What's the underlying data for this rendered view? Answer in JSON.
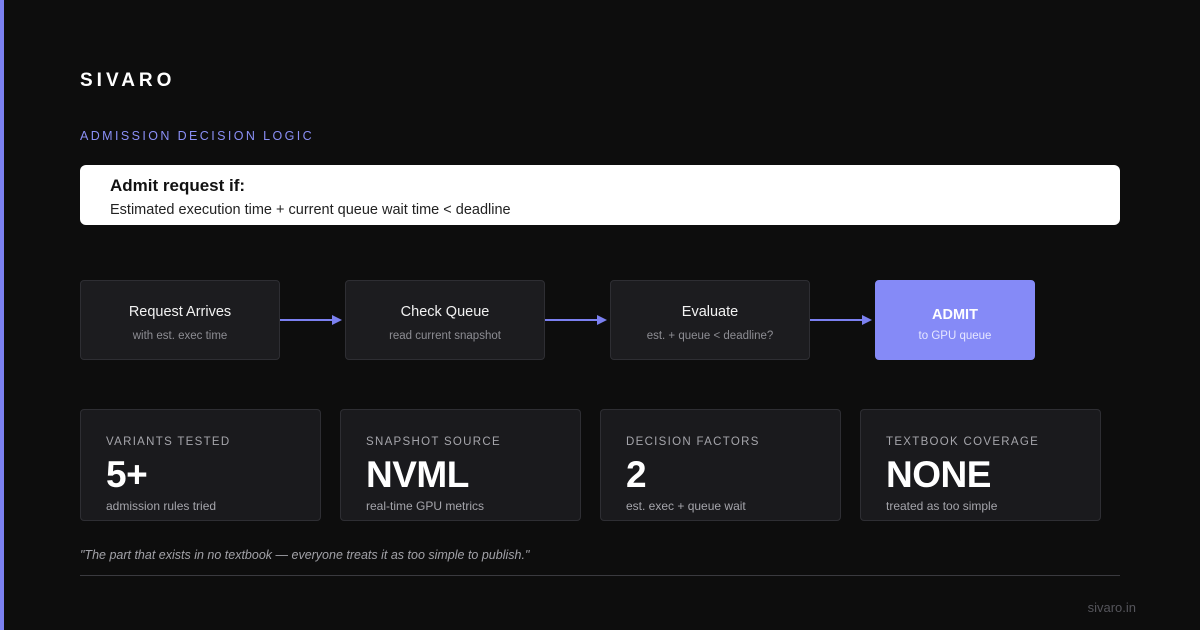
{
  "brand": "SIVARO",
  "section_label": "ADMISSION DECISION LOGIC",
  "rule": {
    "title": "Admit request if:",
    "text": "Estimated execution time + current queue wait time < deadline"
  },
  "flow": [
    {
      "title": "Request Arrives",
      "sub": "with est. exec time"
    },
    {
      "title": "Check Queue",
      "sub": "read current snapshot"
    },
    {
      "title": "Evaluate",
      "sub": "est. + queue < deadline?"
    },
    {
      "title": "ADMIT",
      "sub": "to GPU queue"
    }
  ],
  "stats": [
    {
      "label": "VARIANTS TESTED",
      "value": "5+",
      "sub": "admission rules tried"
    },
    {
      "label": "SNAPSHOT SOURCE",
      "value": "NVML",
      "sub": "real-time GPU metrics"
    },
    {
      "label": "DECISION FACTORS",
      "value": "2",
      "sub": "est. exec + queue wait"
    },
    {
      "label": "TEXTBOOK COVERAGE",
      "value": "NONE",
      "sub": "treated as too simple"
    }
  ],
  "quote": "\"The part that exists in no textbook — everyone treats it as too simple to publish.\"",
  "footer_url": "sivaro.in",
  "colors": {
    "accent": "#7b80f0",
    "admit_fill": "#858af7",
    "background": "#0d0d0d"
  }
}
